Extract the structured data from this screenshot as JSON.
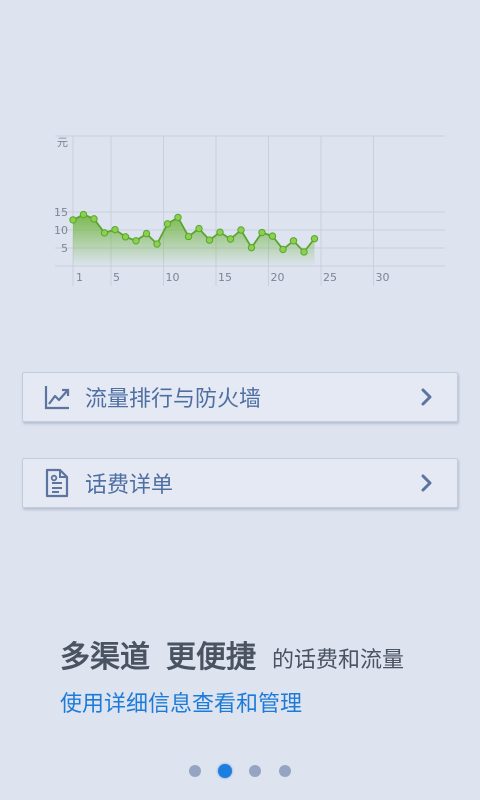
{
  "chart_data": {
    "type": "area",
    "ylabel": "元",
    "x_ticks": [
      1,
      5,
      10,
      15,
      20,
      25,
      30
    ],
    "y_ticks": [
      5,
      10,
      15
    ],
    "xlim": [
      1,
      32
    ],
    "ylim": [
      0,
      18
    ],
    "grid": true,
    "series": [
      {
        "x": [
          1,
          2,
          3,
          4,
          5,
          6,
          7,
          8,
          9,
          10,
          11,
          12,
          13,
          14,
          15,
          16,
          17,
          18,
          19,
          20,
          21,
          22,
          23,
          24
        ],
        "values": [
          12.8,
          14.3,
          13.1,
          9.2,
          10.1,
          8.1,
          7.0,
          9.0,
          6.1,
          11.7,
          13.5,
          8.2,
          10.4,
          7.2,
          9.4,
          7.5,
          10.0,
          5.1,
          9.3,
          8.3,
          4.6,
          7.0,
          3.9,
          7.6
        ]
      }
    ],
    "line_color": "#5aa52e",
    "point_color": "#8ad14f"
  },
  "menu": {
    "traffic_label": "流量排行与防火墙",
    "bill_label": "话费详单",
    "traffic_icon": "trend-chart-icon",
    "bill_icon": "document-icon"
  },
  "promo": {
    "headline_1": "多渠道",
    "headline_2": "更便捷",
    "headline_tail": "的话费和流量",
    "subline": "使用详细信息查看和管理"
  },
  "pager": {
    "count": 4,
    "active_index": 1
  }
}
